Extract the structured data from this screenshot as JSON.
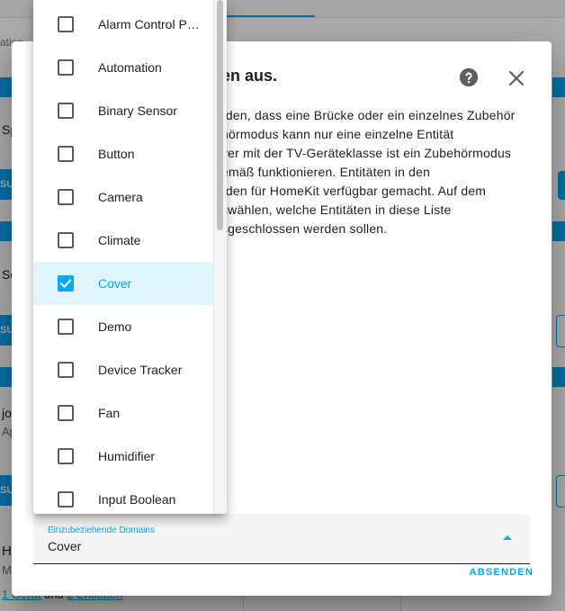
{
  "background": {
    "partial_text_1": "ation",
    "partial_text_2": "Sp",
    "partial_text_3": "Se",
    "button_partial": "SU",
    "partial_text_4": "jo",
    "partial_text_5": "Ap",
    "partial_text_6": "H",
    "partial_text_7": "M",
    "footer_link_1": "1 Gerät",
    "footer_and": "und",
    "footer_link_2": "2 Entitäten"
  },
  "dialog": {
    "title": "en aus.",
    "body_lines": [
      "erden, dass eine Brücke oder ein einzelnes Zubehör",
      "ehörmodus kann nur eine einzelne Entität",
      "ayer mit der TV-Geräteklasse ist ein Zubehörmodus",
      "gemäß funktionieren. Entitäten in den",
      "erden für HomeKit verfügbar gemacht. Auf dem",
      "uswählen, welche Entitäten in diese Liste",
      "usgeschlossen werden sollen."
    ],
    "select": {
      "label": "Einzubeziehende Domains",
      "value": "Cover"
    },
    "submit_label": "ABSENDEN"
  },
  "menu": {
    "items": [
      {
        "label": "Alarm Control P…",
        "checked": false
      },
      {
        "label": "Automation",
        "checked": false
      },
      {
        "label": "Binary Sensor",
        "checked": false
      },
      {
        "label": "Button",
        "checked": false
      },
      {
        "label": "Camera",
        "checked": false
      },
      {
        "label": "Climate",
        "checked": false
      },
      {
        "label": "Cover",
        "checked": true
      },
      {
        "label": "Demo",
        "checked": false
      },
      {
        "label": "Device Tracker",
        "checked": false
      },
      {
        "label": "Fan",
        "checked": false
      },
      {
        "label": "Humidifier",
        "checked": false
      },
      {
        "label": "Input Boolean",
        "checked": false
      }
    ]
  },
  "colors": {
    "accent": "#03a9f4",
    "selected_bg": "#e1f5fe"
  },
  "icons": {
    "help": "help-circle-icon",
    "close": "close-icon",
    "check": "check-icon",
    "dropdown": "triangle-up-icon"
  }
}
